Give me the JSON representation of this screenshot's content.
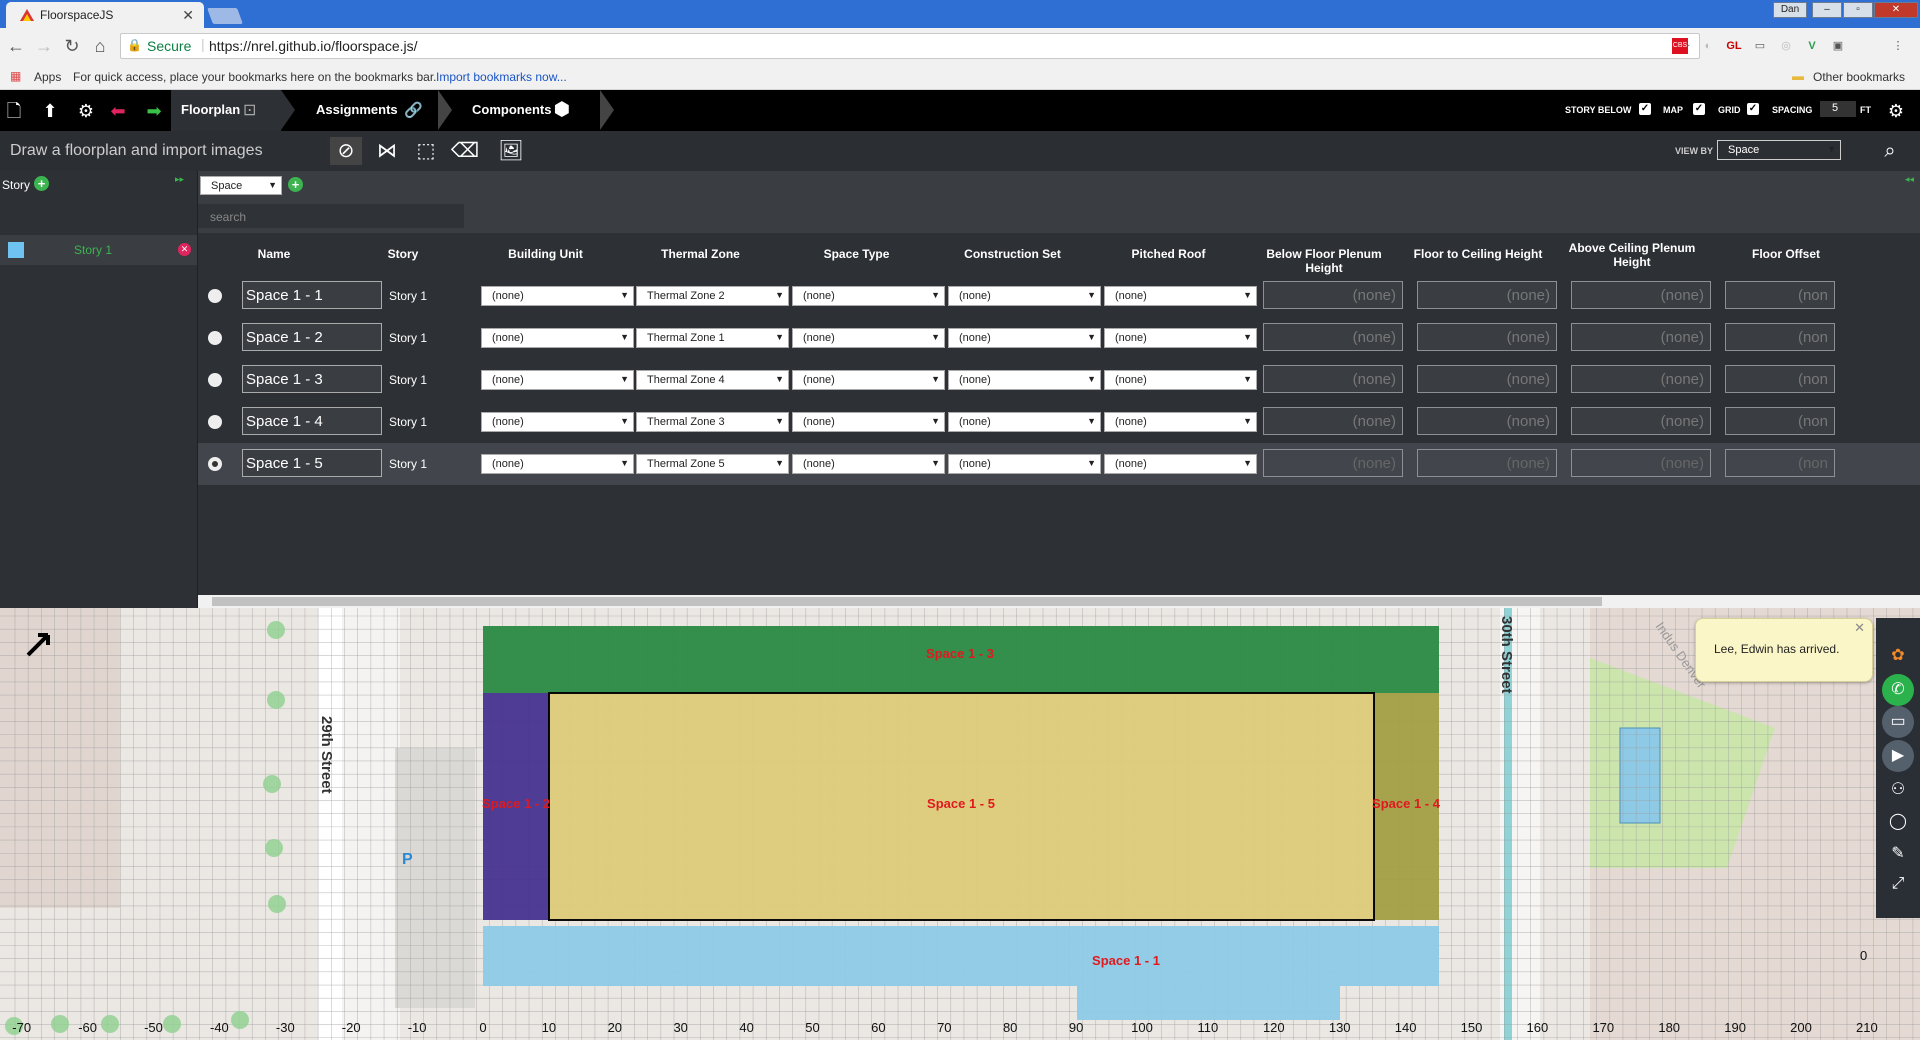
{
  "browser": {
    "tab_title": "FloorspaceJS",
    "user": "Dan",
    "secure_label": "Secure",
    "url": "https://nrel.github.io/floorspace.js/",
    "bookmarks_apps": "Apps",
    "bookmarks_hint": "For quick access, place your bookmarks here on the bookmarks bar.",
    "bookmarks_import": "Import bookmarks now...",
    "other_bookmarks": "Other bookmarks"
  },
  "app": {
    "tabs": [
      "Floorplan",
      "Assignments",
      "Components"
    ],
    "options": {
      "story_below": "STORY BELOW",
      "map": "MAP",
      "grid": "GRID",
      "spacing": "SPACING",
      "spacing_value": "5",
      "spacing_unit": "FT"
    },
    "instruction": "Draw a floorplan and import images",
    "view_by_label": "VIEW BY",
    "view_by_value": "Space"
  },
  "sidebar": {
    "story_label": "Story",
    "stories": [
      "Story 1"
    ]
  },
  "grid": {
    "type_select": "Space",
    "search_placeholder": "search",
    "headers": [
      "Name",
      "Story",
      "Building Unit",
      "Thermal Zone",
      "Space Type",
      "Construction Set",
      "Pitched Roof",
      "Below Floor Plenum Height",
      "Floor to Ceiling Height",
      "Above Ceiling Plenum Height",
      "Floor Offset"
    ],
    "rows": [
      {
        "name": "Space 1 - 1",
        "story": "Story 1",
        "building_unit": "(none)",
        "thermal_zone": "Thermal Zone 2",
        "space_type": "(none)",
        "construction_set": "(none)",
        "pitched_roof": "(none)",
        "below": "(none)",
        "f2c": "(none)",
        "above": "(none)",
        "offset": "(non"
      },
      {
        "name": "Space 1 - 2",
        "story": "Story 1",
        "building_unit": "(none)",
        "thermal_zone": "Thermal Zone 1",
        "space_type": "(none)",
        "construction_set": "(none)",
        "pitched_roof": "(none)",
        "below": "(none)",
        "f2c": "(none)",
        "above": "(none)",
        "offset": "(non"
      },
      {
        "name": "Space 1 - 3",
        "story": "Story 1",
        "building_unit": "(none)",
        "thermal_zone": "Thermal Zone 4",
        "space_type": "(none)",
        "construction_set": "(none)",
        "pitched_roof": "(none)",
        "below": "(none)",
        "f2c": "(none)",
        "above": "(none)",
        "offset": "(non"
      },
      {
        "name": "Space 1 - 4",
        "story": "Story 1",
        "building_unit": "(none)",
        "thermal_zone": "Thermal Zone 3",
        "space_type": "(none)",
        "construction_set": "(none)",
        "pitched_roof": "(none)",
        "below": "(none)",
        "f2c": "(none)",
        "above": "(none)",
        "offset": "(non"
      },
      {
        "name": "Space 1 - 5",
        "story": "Story 1",
        "building_unit": "(none)",
        "thermal_zone": "Thermal Zone 5",
        "space_type": "(none)",
        "construction_set": "(none)",
        "pitched_roof": "(none)",
        "below": "(none)",
        "f2c": "(none)",
        "above": "(none)",
        "offset": "(non"
      }
    ],
    "selected_row": 4
  },
  "canvas": {
    "spaces": [
      {
        "label": "Space 1 - 1",
        "color": "#8ecae6"
      },
      {
        "label": "Space 1 - 2",
        "color": "#47338f"
      },
      {
        "label": "Space 1 - 3",
        "color": "#2a8a43"
      },
      {
        "label": "Space 1 - 4",
        "color": "#a39e43"
      },
      {
        "label": "Space 1 - 5",
        "color": "#dfcc7a"
      }
    ],
    "streets": [
      "29th Street",
      "30th Street"
    ],
    "map_fragment": "Indus Denver",
    "x_ticks": [
      "-70",
      "-60",
      "-50",
      "-40",
      "-30",
      "-20",
      "-10",
      "0",
      "10",
      "20",
      "30",
      "40",
      "50",
      "60",
      "70",
      "80",
      "90",
      "100",
      "110",
      "120",
      "130",
      "140",
      "150",
      "160",
      "170",
      "180",
      "190",
      "200",
      "210"
    ],
    "y_tick": "0"
  },
  "notification": {
    "text": "Lee, Edwin has arrived."
  }
}
